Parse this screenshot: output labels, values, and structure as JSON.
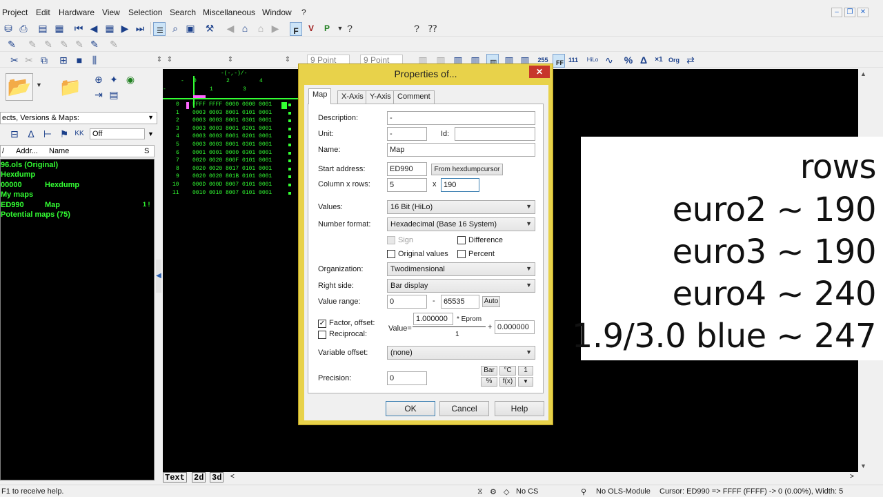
{
  "menu": [
    "Project",
    "Edit",
    "Hardware",
    "View",
    "Selection",
    "Search",
    "Miscellaneous",
    "Window",
    "?"
  ],
  "toolbar3": {
    "font1": "9 Point",
    "font2": "9 Point"
  },
  "left": {
    "dropdown": "ects, Versions & Maps:",
    "off_btn": "Off",
    "col_addr": "Addr...",
    "col_name": "Name",
    "col_s": "S",
    "tree": [
      {
        "text": "96.ols (Original)"
      },
      {
        "text": "Hexdump"
      },
      {
        "addr": "00000",
        "name": "Hexdump"
      },
      {
        "text": "My maps"
      },
      {
        "addr": "ED990",
        "name": "Map",
        "s": "1 !"
      },
      {
        "text": "Potential maps (75)"
      }
    ]
  },
  "hex": {
    "hdr_top": "-(-,-)/-",
    "hdr_cols": [
      "0",
      "2",
      "4"
    ],
    "hdr_cols2": [
      "1",
      "3"
    ],
    "rows": [
      {
        "idx": "0",
        "data": "FFFF FFFF 0000 0000 0001"
      },
      {
        "idx": "1",
        "data": "0003 0003 8001 0101 0001"
      },
      {
        "idx": "2",
        "data": "0003 0003 8001 0301 0001"
      },
      {
        "idx": "3",
        "data": "0003 0003 8001 0201 0001"
      },
      {
        "idx": "4",
        "data": "0003 0003 8001 0201 0001"
      },
      {
        "idx": "5",
        "data": "0003 0003 8001 0301 0001"
      },
      {
        "idx": "6",
        "data": "0001 0001 0000 0301 0001"
      },
      {
        "idx": "7",
        "data": "0020 0020 800F 0101 0001"
      },
      {
        "idx": "8",
        "data": "0020 0020 8017 0101 0001"
      },
      {
        "idx": "9",
        "data": "0020 0020 801B 0101 0001"
      },
      {
        "idx": "10",
        "data": "000D 000D 8007 0101 0001"
      },
      {
        "idx": "11",
        "data": "0010 0010 8007 0101 0001"
      }
    ]
  },
  "tabs_bottom": [
    "Text",
    "2d",
    "3d"
  ],
  "status": {
    "help": "F1 to receive help.",
    "cs": "No CS",
    "module": "No OLS-Module",
    "cursor": "Cursor: ED990 => FFFF (FFFF) -> 0 (0.00%), Width: 5"
  },
  "overlay": {
    "lines": [
      "rows",
      "euro2 ~ 190",
      "euro3 ~ 190",
      "euro4 ~ 240",
      "1.9/3.0 blue ~ 247"
    ]
  },
  "dialog": {
    "title": "Properties of...",
    "close": "✕",
    "tabs": [
      "Map",
      "X-Axis",
      "Y-Axis",
      "Comment"
    ],
    "description_label": "Description:",
    "description_value": "-",
    "unit_label": "Unit:",
    "unit_value": "-",
    "id_label": "Id:",
    "id_value": "",
    "name_label": "Name:",
    "name_value": "Map",
    "start_label": "Start address:",
    "start_value": "ED990",
    "from_hexdump": "From hexdumpcursor",
    "colrows_label": "Column x rows:",
    "cols_value": "5",
    "x_sep": "x",
    "rows_value": "190",
    "values_label": "Values:",
    "values_value": "16 Bit (HiLo)",
    "numfmt_label": "Number format:",
    "numfmt_value": "Hexadecimal  (Base 16 System)",
    "sign": "Sign",
    "difference": "Difference",
    "original_values": "Original values",
    "percent": "Percent",
    "org_label": "Organization:",
    "org_value": "Twodimensional",
    "right_label": "Right side:",
    "right_value": "Bar display",
    "range_label": "Value range:",
    "range_min": "0",
    "range_dash": "-",
    "range_max": "65535",
    "auto": "Auto",
    "factor_offset": "Factor, offset:",
    "reciprocal": "Reciprocal:",
    "value_eq": "Value=",
    "factor": "1.000000",
    "eprom": "* Eprom",
    "denom": "1",
    "plus": "+",
    "offset": "0.000000",
    "varoffset_label": "Variable offset:",
    "varoffset_value": "(none)",
    "precision_label": "Precision:",
    "precision_value": "0",
    "bar": "Bar",
    "celsius": "°C",
    "one": "1",
    "pct": "%",
    "fx": "f(x)",
    "down": "▼",
    "ok": "OK",
    "cancel": "Cancel",
    "help": "Help"
  }
}
